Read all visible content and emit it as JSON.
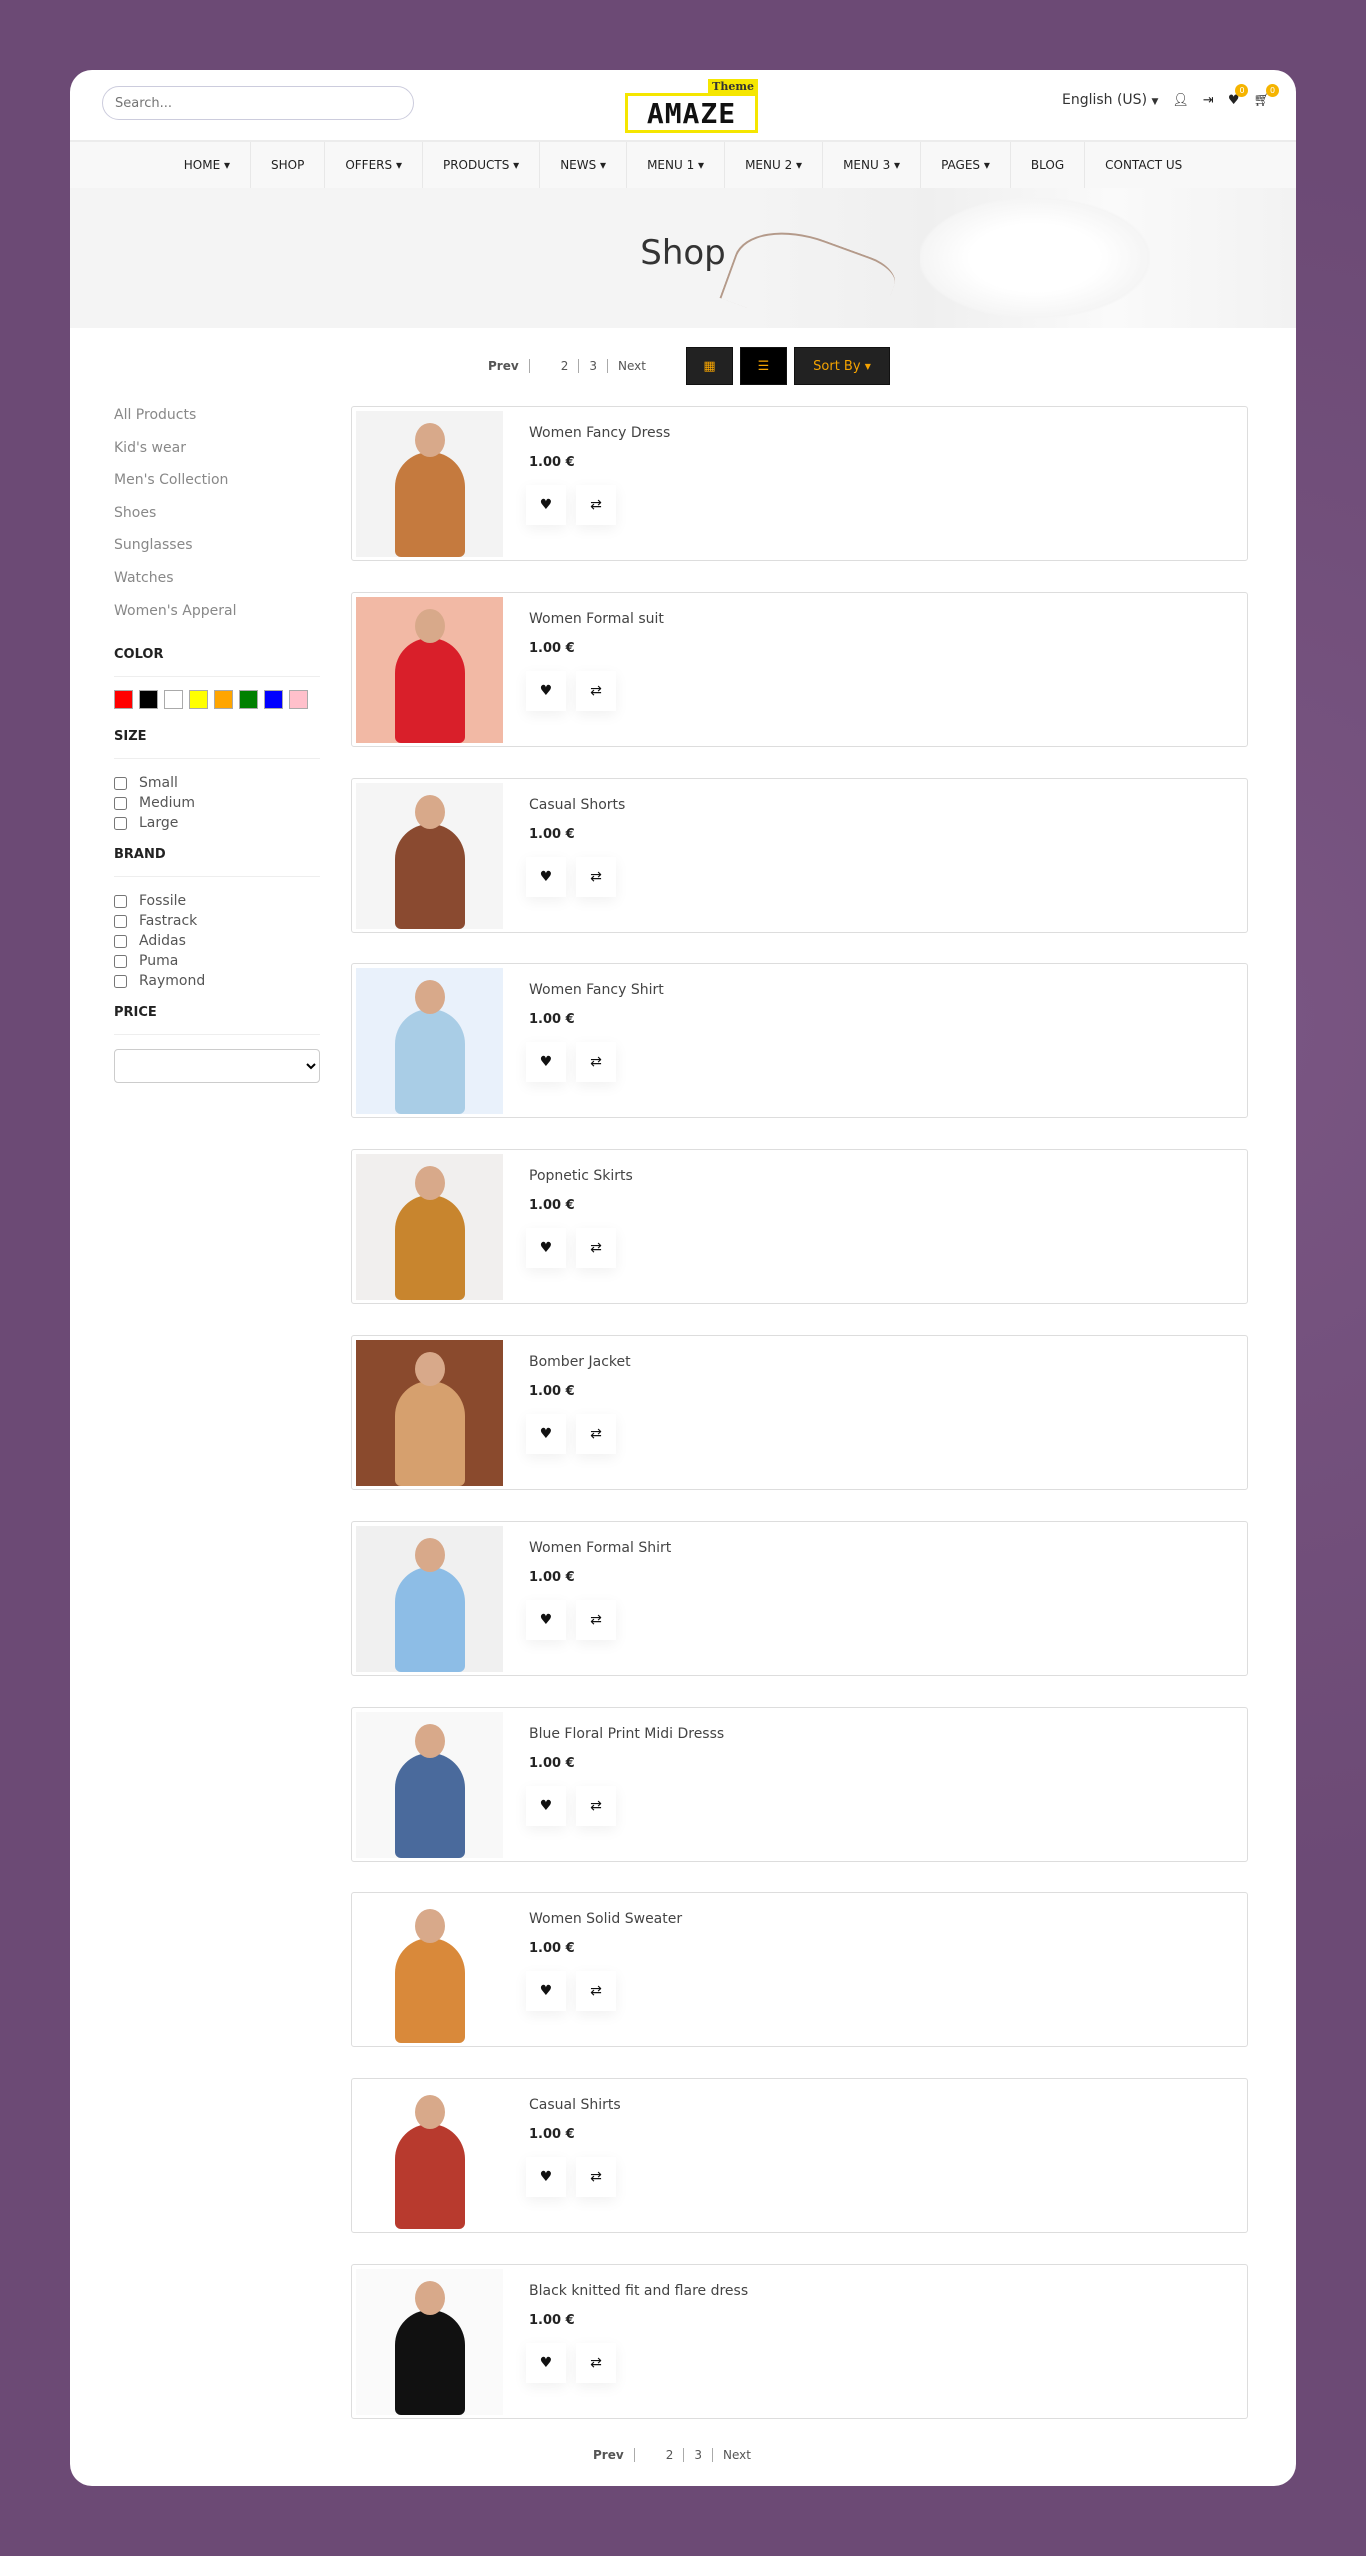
{
  "header": {
    "search_placeholder": "Search...",
    "logo_word": "AMAZE",
    "logo_tag": "Theme",
    "language": "English (US)",
    "wishlist_count": "0",
    "cart_count": "0"
  },
  "nav": [
    "HOME",
    "SHOP",
    "OFFERS",
    "PRODUCTS",
    "NEWS",
    "MENU 1",
    "MENU 2",
    "MENU 3",
    "PAGES",
    "BLOG",
    "CONTACT US"
  ],
  "nav_dropdown": [
    true,
    false,
    true,
    true,
    true,
    true,
    true,
    true,
    true,
    false,
    false
  ],
  "banner": {
    "title": "Shop"
  },
  "pagination": {
    "prev": "Prev",
    "pages": [
      "",
      "2",
      "3"
    ],
    "next": "Next"
  },
  "toolbar": {
    "sort_label": "Sort By",
    "accent": "#f5a300"
  },
  "sidebar": {
    "categories": [
      "All Products",
      "Kid's wear",
      "Men's Collection",
      "Shoes",
      "Sunglasses",
      "Watches",
      "Women's Apperal"
    ],
    "color_title": "COLOR",
    "colors": [
      "#ff0000",
      "#000000",
      "#ffffff",
      "#ffff00",
      "#ffa500",
      "#008000",
      "#0000ff",
      "#ffc0cb"
    ],
    "size_title": "SIZE",
    "sizes": [
      "Small",
      "Medium",
      "Large"
    ],
    "brand_title": "BRAND",
    "brands": [
      "Fossile",
      "Fastrack",
      "Adidas",
      "Puma",
      "Raymond"
    ],
    "price_title": "PRICE",
    "price_value": ""
  },
  "products": [
    {
      "name": "Women Fancy Dress",
      "price": "1.00 €",
      "bg": "#f3f3f3",
      "tone": "#c57a3e"
    },
    {
      "name": "Women Formal suit",
      "price": "1.00 €",
      "bg": "#f2b9a5",
      "tone": "#d91f2a"
    },
    {
      "name": "Casual Shorts",
      "price": "1.00 €",
      "bg": "#f5f5f5",
      "tone": "#8a4a30"
    },
    {
      "name": "Women Fancy Shirt",
      "price": "1.00 €",
      "bg": "#e9f1fb",
      "tone": "#a9cde6"
    },
    {
      "name": "Popnetic Skirts",
      "price": "1.00 €",
      "bg": "#f1efee",
      "tone": "#c8852e"
    },
    {
      "name": "Bomber Jacket",
      "price": "1.00 €",
      "bg": "#8a4a2d",
      "tone": "#d6a06e"
    },
    {
      "name": "Women Formal Shirt",
      "price": "1.00 €",
      "bg": "#f0f0f0",
      "tone": "#8dbde6"
    },
    {
      "name": "Blue Floral Print Midi Dresss",
      "price": "1.00 €",
      "bg": "#f8f8f8",
      "tone": "#4a6a9c"
    },
    {
      "name": "Women Solid Sweater",
      "price": "1.00 €",
      "bg": "#ffffff",
      "tone": "#d9893a"
    },
    {
      "name": "Casual Shirts",
      "price": "1.00 €",
      "bg": "#ffffff",
      "tone": "#b83a2e"
    },
    {
      "name": "Black knitted fit and flare dress",
      "price": "1.00 €",
      "bg": "#fafafa",
      "tone": "#111111"
    }
  ]
}
